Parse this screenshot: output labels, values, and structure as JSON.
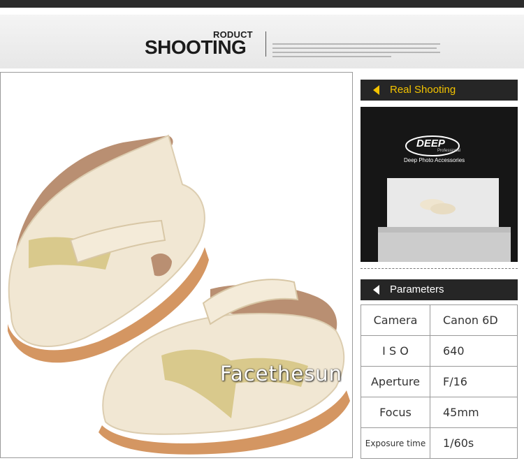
{
  "header": {
    "subtitle": "RODUCT",
    "title": "SHOOTING"
  },
  "watermark": "Facethesun",
  "sidebar": {
    "real_shooting_label": "Real Shooting",
    "studio_brand": "DEEP",
    "studio_brand_sub": "Professional",
    "studio_caption": "Deep Photo Accessories",
    "parameters_label": "Parameters",
    "parameters": [
      {
        "key": "Camera",
        "value": "Canon  6D"
      },
      {
        "key": "I  S  O",
        "value": "640"
      },
      {
        "key": "Aperture",
        "value": "F/16"
      },
      {
        "key": "Focus",
        "value": "45mm"
      },
      {
        "key": "Exposure time",
        "value": "1/60s"
      }
    ]
  },
  "colors": {
    "accent": "#f3c300",
    "bar": "#262626",
    "shoe": "#f1e7d3",
    "sole": "#d49662",
    "gold": "#d9c98c"
  }
}
